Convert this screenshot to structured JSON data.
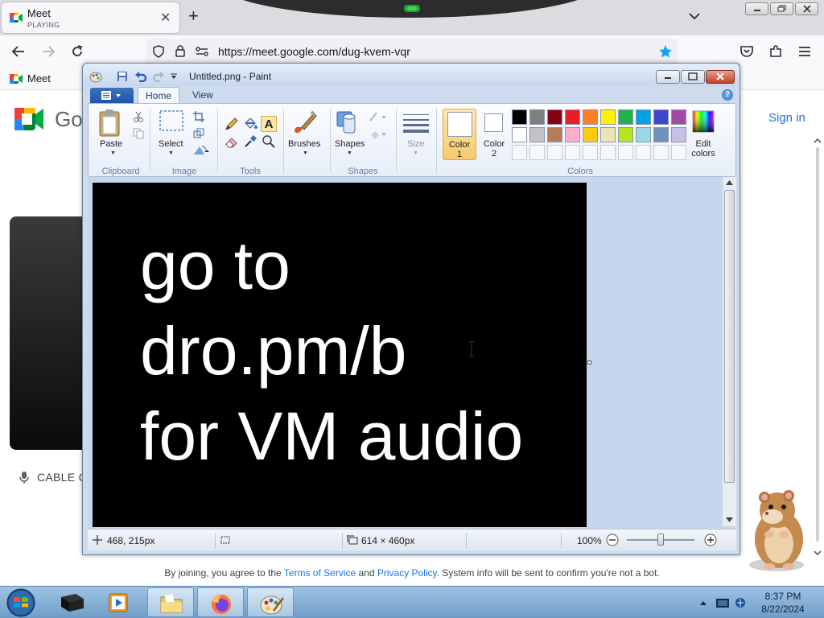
{
  "browser": {
    "tab": {
      "title": "Meet",
      "status": "PLAYING",
      "close": "✕"
    },
    "new_tab": "+",
    "url": "https://meet.google.com/dug-kvem-vqr",
    "bookmark": "Meet"
  },
  "meet": {
    "logo_text": "Go",
    "sign_in": "Sign in",
    "mic_label": "CABLE C",
    "join": {
      "prefix": "By joining, you agree to the",
      "terms": "Terms of Service",
      "and": "and",
      "privacy": "Privacy Policy",
      "suffix": ". System info will be sent to confirm you're not a bot."
    }
  },
  "paint": {
    "title": "Untitled.png - Paint",
    "tabs": {
      "home": "Home",
      "view": "View"
    },
    "groups": {
      "clipboard": "Clipboard",
      "image": "Image",
      "tools": "Tools",
      "shapes": "Shapes",
      "colors": "Colors"
    },
    "buttons": {
      "paste": "Paste",
      "select": "Select",
      "brushes": "Brushes",
      "shapes": "Shapes",
      "size": "Size",
      "color1": "Color",
      "color1_num": "1",
      "color2": "Color",
      "color2_num": "2",
      "edit": "Edit",
      "colors": "colors"
    },
    "palette_row1": [
      "#000000",
      "#7f7f7f",
      "#880015",
      "#ed1c24",
      "#ff7f27",
      "#fff200",
      "#22b14c",
      "#00a2e8",
      "#3f48cc",
      "#a349a4"
    ],
    "palette_row2": [
      "#ffffff",
      "#c3c3c3",
      "#b97a57",
      "#ffaec9",
      "#ffc90e",
      "#efe4b0",
      "#b5e61d",
      "#99d9ea",
      "#7092be",
      "#c8bfe7"
    ],
    "canvas_text": "go to\ndro.pm/b\nfor VM audio",
    "status": {
      "cursor": "468, 215px",
      "size": "614 × 460px",
      "zoom": "100%"
    }
  },
  "taskbar": {
    "time": "8:37 PM",
    "date": "8/22/2024"
  }
}
